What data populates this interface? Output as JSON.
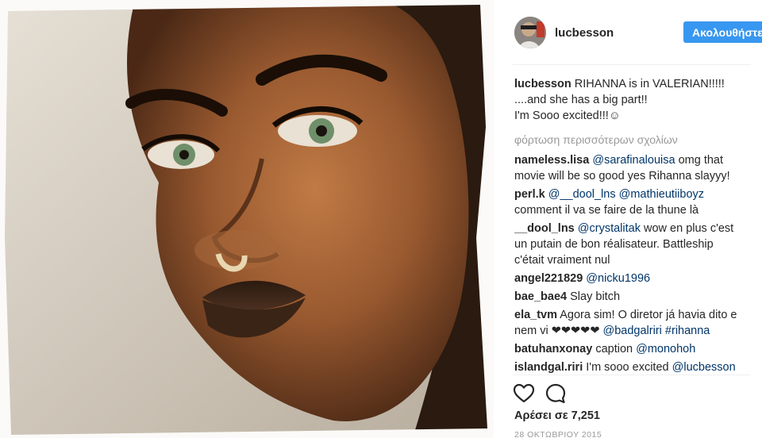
{
  "post": {
    "username": "lucbesson",
    "follow_label": "Ακολουθήστε"
  },
  "caption": {
    "user": "lucbesson",
    "lines": [
      "RIHANNA is in VALERIAN!!!!!",
      "....and she has a big part!!",
      "I'm Sooo excited!!!☺"
    ]
  },
  "load_more": "φόρτωση περισσότερων σχολίων",
  "comments": [
    {
      "user": "nameless.lisa",
      "mention": "@sarafinalouisa",
      "text": " omg that",
      "line2": "movie will be so good yes Rihanna slayyy!"
    },
    {
      "user": "perl.k",
      "mention": "@__dool_lns",
      "mention2": "@mathieutiiboyz",
      "line2": "comment il va se faire de la thune là"
    },
    {
      "user": "__dool_lns",
      "mention": "@crystalitak",
      "text": " wow en plus c'est",
      "line2": "un putain de bon réalisateur. Battleship",
      "line3": "c'était vraiment nul"
    },
    {
      "user": "angel221829",
      "mention": "@nicku1996"
    },
    {
      "user": "bae_bae4",
      "text": "Slay bitch"
    },
    {
      "user": "ela_tvm",
      "text": "Agora sim! O diretor já havia dito e",
      "line2": "nem vi ❤❤❤❤❤ ",
      "mention": "@badgalriri",
      "mention2": "#rihanna"
    },
    {
      "user": "batuhanxonay",
      "text": "caption ",
      "mention": "@monohoh"
    },
    {
      "user": "islandgal.riri",
      "text": "I'm sooo excited ",
      "mention": "@lucbesson",
      "line2": "☹"
    }
  ],
  "likes": "Αρέσει σε 7,251",
  "date": "28 ΟΚΤΩΒΡΙΟΥ 2015",
  "icons": {
    "like": "heart-icon",
    "comment": "comment-bubble-icon"
  },
  "colors": {
    "follow_button": "#3897f0",
    "mention": "#003569",
    "muted": "#999999"
  }
}
